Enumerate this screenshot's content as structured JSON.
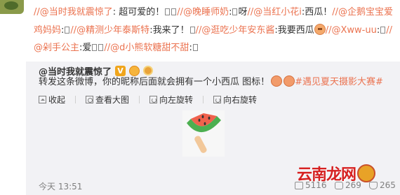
{
  "repost": {
    "segments": [
      {
        "kind": "sep",
        "text": "//"
      },
      {
        "kind": "mention",
        "text": "@当时我就震惊了"
      },
      {
        "kind": "text",
        "text": ": 超可爱的！"
      },
      {
        "kind": "box"
      },
      {
        "kind": "box"
      },
      {
        "kind": "sep",
        "text": "//"
      },
      {
        "kind": "mention",
        "text": "@晚睡师奶"
      },
      {
        "kind": "text",
        "text": ":"
      },
      {
        "kind": "box"
      },
      {
        "kind": "text",
        "text": "呀"
      },
      {
        "kind": "sep",
        "text": "//"
      },
      {
        "kind": "mention",
        "text": "@当红小花i"
      },
      {
        "kind": "text",
        "text": ":西瓜！"
      },
      {
        "kind": "sep",
        "text": "//"
      },
      {
        "kind": "mention",
        "text": "@企鹅宝宝爱鸡妈妈"
      },
      {
        "kind": "text",
        "text": ":"
      },
      {
        "kind": "box"
      },
      {
        "kind": "sep",
        "text": "//"
      },
      {
        "kind": "mention",
        "text": "@精测少年泰斯特"
      },
      {
        "kind": "text",
        "text": ":我来了！"
      },
      {
        "kind": "box"
      },
      {
        "kind": "sep",
        "text": "//"
      },
      {
        "kind": "mention",
        "text": "@逛吃少年安东酱"
      },
      {
        "kind": "text",
        "text": ":我要西瓜"
      },
      {
        "kind": "emoji"
      },
      {
        "kind": "sep",
        "text": "//"
      },
      {
        "kind": "mention",
        "text": "@Xww-uu"
      },
      {
        "kind": "text",
        "text": ":"
      },
      {
        "kind": "box"
      },
      {
        "kind": "sep",
        "text": "//"
      },
      {
        "kind": "mention",
        "text": "@剁手公主"
      },
      {
        "kind": "text",
        "text": ":爱"
      },
      {
        "kind": "box"
      },
      {
        "kind": "box"
      },
      {
        "kind": "sep",
        "text": "//"
      },
      {
        "kind": "mention",
        "text": "@d小熊软糖甜不甜"
      },
      {
        "kind": "text",
        "text": ":"
      },
      {
        "kind": "box"
      }
    ]
  },
  "original": {
    "author": "@当时我就震惊了",
    "badge_v": "V",
    "text": "转发这条微博，你的昵称后面就会拥有一个小西瓜 图标！",
    "topic": "#遇见夏天摄影大赛#"
  },
  "media_toolbar": {
    "collapse": "收起",
    "zoom": "查看大图",
    "rotate_left": "向左旋转",
    "rotate_right": "向右旋转"
  },
  "image": {
    "subject": "watermelon-popsicle",
    "rind_color": "#4caf50",
    "flesh_color": "#f0624d",
    "stick_color": "#f2c89a"
  },
  "footer": {
    "time": "今天 13:51",
    "repost_count": "5116",
    "comment_count": "269",
    "like_count": "265"
  },
  "watermark": {
    "text": "云南龙网"
  },
  "colors": {
    "accent": "#eb7350",
    "text": "#333333",
    "muted": "#808080",
    "orig_bg": "#f2f2f5"
  }
}
